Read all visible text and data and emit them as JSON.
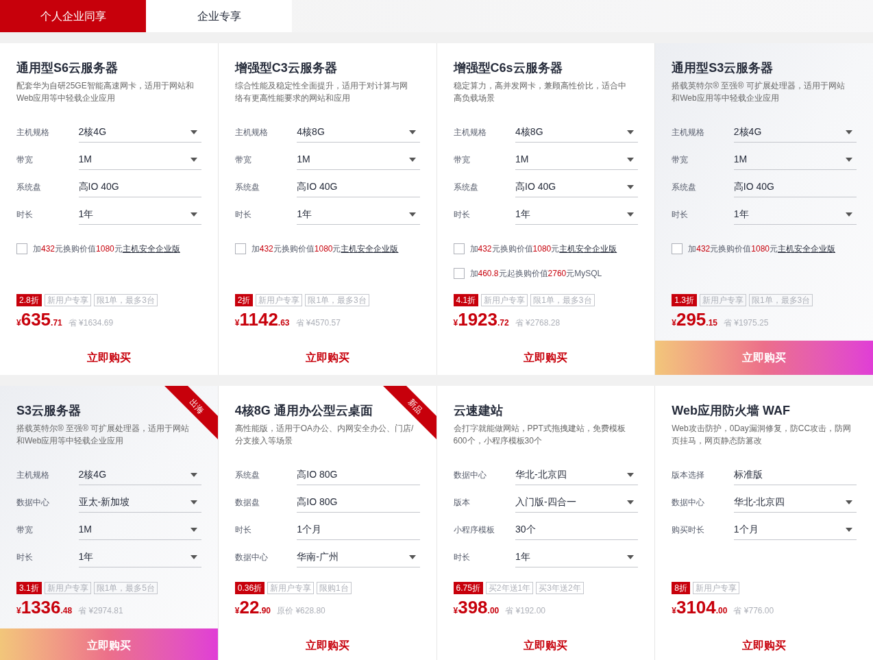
{
  "tabs": [
    {
      "label": "个人企业同享",
      "selected": true
    },
    {
      "label": "企业专享",
      "selected": false
    }
  ],
  "rows": [
    {
      "cards": [
        {
          "title": "通用型S6云服务器",
          "description": "配套华为自研25GE智能高速网卡，适用于网站和Web应用等中轻载企业应用",
          "highlighted": false,
          "fields": [
            {
              "label": "主机规格",
              "value": "2核4G",
              "dropdown": true
            },
            {
              "label": "带宽",
              "value": "1M",
              "dropdown": true
            },
            {
              "label": "系统盘",
              "value": "高IO 40G",
              "dropdown": false
            },
            {
              "label": "时长",
              "value": "1年",
              "dropdown": true
            }
          ],
          "options": [
            {
              "checked": false,
              "segments": [
                {
                  "kind": "plain",
                  "text": "加"
                },
                {
                  "kind": "accent",
                  "text": "432"
                },
                {
                  "kind": "plain",
                  "text": "元换购价值"
                },
                {
                  "kind": "accent",
                  "text": "1080"
                },
                {
                  "kind": "plain",
                  "text": "元"
                },
                {
                  "kind": "link",
                  "text": "主机安全企业版"
                }
              ]
            }
          ],
          "discount": "2.8折",
          "tags": [
            "新用户专享",
            "限1单，最多3台"
          ],
          "currency": "¥",
          "price": "635",
          "cents": ".71",
          "original": "省 ¥1634.69",
          "button": "立即购买"
        },
        {
          "title": "增强型C3云服务器",
          "description": "综合性能及稳定性全面提升，适用于对计算与网络有更高性能要求的网站和应用",
          "highlighted": false,
          "fields": [
            {
              "label": "主机规格",
              "value": "4核8G",
              "dropdown": true
            },
            {
              "label": "带宽",
              "value": "1M",
              "dropdown": true
            },
            {
              "label": "系统盘",
              "value": "高IO 40G",
              "dropdown": false
            },
            {
              "label": "时长",
              "value": "1年",
              "dropdown": true
            }
          ],
          "options": [
            {
              "checked": false,
              "segments": [
                {
                  "kind": "plain",
                  "text": "加"
                },
                {
                  "kind": "accent",
                  "text": "432"
                },
                {
                  "kind": "plain",
                  "text": "元换购价值"
                },
                {
                  "kind": "accent",
                  "text": "1080"
                },
                {
                  "kind": "plain",
                  "text": "元"
                },
                {
                  "kind": "link",
                  "text": "主机安全企业版"
                }
              ]
            }
          ],
          "discount": "2折",
          "tags": [
            "新用户专享",
            "限1单，最多3台"
          ],
          "currency": "¥",
          "price": "1142",
          "cents": ".63",
          "original": "省 ¥4570.57",
          "button": "立即购买"
        },
        {
          "title": "增强型C6s云服务器",
          "description": "稳定算力，高并发网卡，兼顾高性价比，适合中高负载场景",
          "highlighted": false,
          "fields": [
            {
              "label": "主机规格",
              "value": "4核8G",
              "dropdown": true
            },
            {
              "label": "带宽",
              "value": "1M",
              "dropdown": true
            },
            {
              "label": "系统盘",
              "value": "高IO 40G",
              "dropdown": true
            },
            {
              "label": "时长",
              "value": "1年",
              "dropdown": true
            }
          ],
          "options": [
            {
              "checked": false,
              "segments": [
                {
                  "kind": "plain",
                  "text": "加"
                },
                {
                  "kind": "accent",
                  "text": "432"
                },
                {
                  "kind": "plain",
                  "text": "元换购价值"
                },
                {
                  "kind": "accent",
                  "text": "1080"
                },
                {
                  "kind": "plain",
                  "text": "元"
                },
                {
                  "kind": "link",
                  "text": "主机安全企业版"
                }
              ]
            },
            {
              "checked": false,
              "segments": [
                {
                  "kind": "plain",
                  "text": "加"
                },
                {
                  "kind": "accent",
                  "text": "460.8"
                },
                {
                  "kind": "plain",
                  "text": "元起换购价值"
                },
                {
                  "kind": "accent",
                  "text": "2760"
                },
                {
                  "kind": "plain",
                  "text": "元MySQL"
                }
              ]
            }
          ],
          "discount": "4.1折",
          "tags": [
            "新用户专享",
            "限1单，最多3台"
          ],
          "currency": "¥",
          "price": "1923",
          "cents": ".72",
          "original": "省 ¥2768.28",
          "button": "立即购买"
        },
        {
          "title": "通用型S3云服务器",
          "description": "搭载英特尔® 至强® 可扩展处理器，适用于网站和Web应用等中轻载企业应用",
          "highlighted": true,
          "fields": [
            {
              "label": "主机规格",
              "value": "2核4G",
              "dropdown": true
            },
            {
              "label": "带宽",
              "value": "1M",
              "dropdown": true
            },
            {
              "label": "系统盘",
              "value": "高IO 40G",
              "dropdown": false
            },
            {
              "label": "时长",
              "value": "1年",
              "dropdown": true
            }
          ],
          "options": [
            {
              "checked": false,
              "segments": [
                {
                  "kind": "plain",
                  "text": "加"
                },
                {
                  "kind": "accent",
                  "text": "432"
                },
                {
                  "kind": "plain",
                  "text": "元换购价值"
                },
                {
                  "kind": "accent",
                  "text": "1080"
                },
                {
                  "kind": "plain",
                  "text": "元"
                },
                {
                  "kind": "link",
                  "text": "主机安全企业版"
                }
              ]
            }
          ],
          "discount": "1.3折",
          "tags": [
            "新用户专享",
            "限1单，最多3台"
          ],
          "currency": "¥",
          "price": "295",
          "cents": ".15",
          "original": "省 ¥1975.25",
          "button": "立即购买"
        }
      ]
    },
    {
      "cards": [
        {
          "title": "S3云服务器",
          "description": "搭载英特尔® 至强® 可扩展处理器，适用于网站和Web应用等中轻载企业应用",
          "highlighted": true,
          "ribbon": "出海",
          "fields": [
            {
              "label": "主机规格",
              "value": "2核4G",
              "dropdown": true
            },
            {
              "label": "数据中心",
              "value": "亚太-新加坡",
              "dropdown": true
            },
            {
              "label": "带宽",
              "value": "1M",
              "dropdown": true
            },
            {
              "label": "时长",
              "value": "1年",
              "dropdown": true
            }
          ],
          "discount": "3.1折",
          "tags": [
            "新用户专享",
            "限1单，最多5台"
          ],
          "currency": "¥",
          "price": "1336",
          "cents": ".48",
          "original": "省 ¥2974.81",
          "button": "立即购买"
        },
        {
          "title": "4核8G 通用办公型云桌面",
          "description": "高性能版，适用于OA办公、内网安全办公、门店/分支接入等场景",
          "highlighted": false,
          "ribbon": "新品",
          "fields": [
            {
              "label": "系统盘",
              "value": "高IO 80G",
              "dropdown": false
            },
            {
              "label": "数据盘",
              "value": "高IO 80G",
              "dropdown": false
            },
            {
              "label": "时长",
              "value": "1个月",
              "dropdown": false
            },
            {
              "label": "数据中心",
              "value": "华南-广州",
              "dropdown": true
            }
          ],
          "discount": "0.36折",
          "tags": [
            "新用户专享",
            "限购1台"
          ],
          "currency": "¥",
          "price": "22",
          "cents": ".90",
          "original": "原价 ¥628.80",
          "button": "立即购买"
        },
        {
          "title": "云速建站",
          "description": "会打字就能做网站，PPT式拖拽建站，免费模板600个，小程序模板30个",
          "highlighted": false,
          "fields": [
            {
              "label": "数据中心",
              "value": "华北-北京四",
              "dropdown": true
            },
            {
              "label": "版本",
              "value": "入门版-四合一",
              "dropdown": true
            },
            {
              "label": "小程序模板",
              "value": "30个",
              "dropdown": false
            },
            {
              "label": "时长",
              "value": "1年",
              "dropdown": true
            }
          ],
          "discount": "6.75折",
          "tags": [
            "买2年送1年",
            "买3年送2年"
          ],
          "currency": "¥",
          "price": "398",
          "cents": ".00",
          "original": "省 ¥192.00",
          "button": "立即购买"
        },
        {
          "title": "Web应用防火墙 WAF",
          "description": "Web攻击防护，0Day漏洞修复，防CC攻击，防网页挂马，网页静态防篡改",
          "highlighted": false,
          "fields": [
            {
              "label": "版本选择",
              "value": "标准版",
              "dropdown": false
            },
            {
              "label": "数据中心",
              "value": "华北-北京四",
              "dropdown": true
            },
            {
              "label": "购买时长",
              "value": "1个月",
              "dropdown": true
            }
          ],
          "discount": "8折",
          "tags": [
            "新用户专享"
          ],
          "currency": "¥",
          "price": "3104",
          "cents": ".00",
          "original": "省 ¥776.00",
          "button": "立即购买"
        }
      ]
    }
  ]
}
